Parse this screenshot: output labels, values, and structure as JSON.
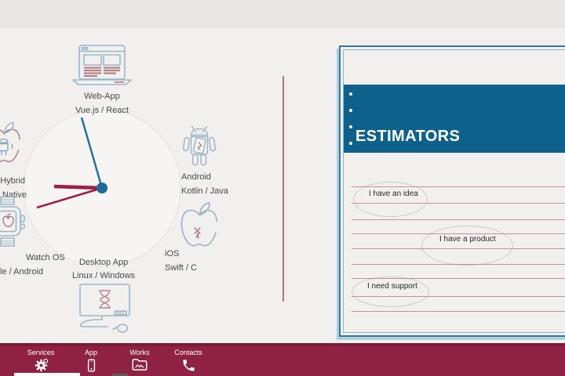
{
  "colors": {
    "accent_maroon": "#8e2144",
    "accent_maroon_dark": "#7a1b3b",
    "accent_teal": "#0e618a",
    "panel_border_teal": "#36789a",
    "ruled_line_pink": "#a85f79",
    "clock_hand_red": "#9e1f44",
    "clock_hand_blue": "#24719d",
    "icon_outline_blue": "#9bb7c8",
    "icon_accent_red": "#b5848b"
  },
  "clock": {
    "platforms": {
      "web": {
        "title": "Web-App",
        "subtitle": "Vue.js / React",
        "icon": "laptop-icon"
      },
      "android": {
        "title": "Android",
        "subtitle": "Kotlin / Java",
        "icon": "android-robot-icon"
      },
      "ios": {
        "title": "iOS",
        "subtitle": "Swift / C",
        "icon": "apple-icon"
      },
      "desktop": {
        "title": "Desktop App",
        "subtitle": "Linux / Windows",
        "icon": "desktop-monitor-icon"
      },
      "watch": {
        "title": "Watch OS",
        "subtitle": "le / Android",
        "icon": "smartwatch-icon"
      },
      "hybrid": {
        "title": "Hybrid",
        "subtitle": "/ Native",
        "icon": "apple-hybrid-icon"
      }
    }
  },
  "estimators": {
    "title": "ESTIMATORS",
    "options": [
      {
        "label": "I have an idea"
      },
      {
        "label": "I have a product"
      },
      {
        "label": "I need support"
      }
    ]
  },
  "nav": {
    "items": [
      {
        "label": "Services",
        "icon": "gear-icon"
      },
      {
        "label": "App",
        "icon": "smartphone-icon"
      },
      {
        "label": "Works",
        "icon": "folder-icon"
      },
      {
        "label": "Contacts",
        "icon": "phone-icon"
      }
    ]
  }
}
